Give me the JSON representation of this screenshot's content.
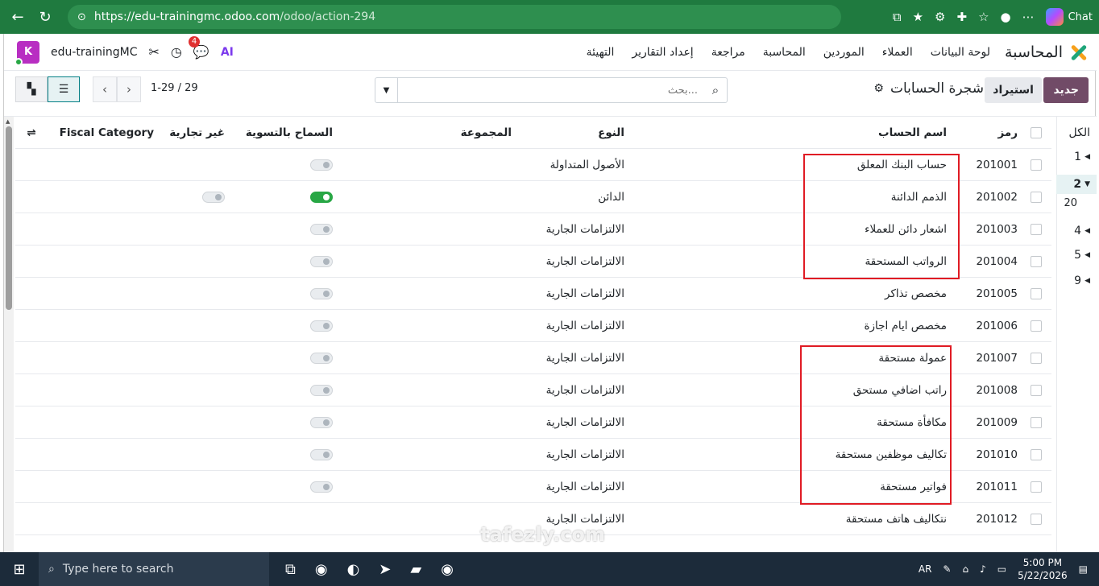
{
  "browser": {
    "url_host": "https://edu-trainingmc.odoo.com",
    "url_path": "/odoo/action-294",
    "chat_label": "Chat"
  },
  "navbar": {
    "app_name": "المحاسبة",
    "menu": [
      "لوحة البيانات",
      "العملاء",
      "الموردين",
      "المحاسبة",
      "مراجعة",
      "إعداد التقارير",
      "التهيئة"
    ],
    "company_initial": "K",
    "company_name": "edu-trainingMC",
    "message_count": "4",
    "ai_label": "AI"
  },
  "control": {
    "new_label": "جديد",
    "import_label": "استيراد",
    "breadcrumb_title": "شجرة الحسابات",
    "search_placeholder": "بحث...",
    "pager": "1-29 / 29"
  },
  "table": {
    "headers": {
      "code": "رمز",
      "name": "اسم الحساب",
      "type": "النوع",
      "group": "المجموعة",
      "reconcile": "السماح بالتسوية",
      "non_trade": "غير تجارية",
      "fiscal": "Fiscal Category"
    },
    "rows": [
      {
        "code": "201001",
        "name": "حساب البنك المعلق",
        "type": "الأصول المتداولة",
        "reconcile": false,
        "non_trade": null
      },
      {
        "code": "201002",
        "name": "الذمم الدائنة",
        "type": "الدائن",
        "reconcile": true,
        "non_trade": false
      },
      {
        "code": "201003",
        "name": "اشعار دائن للعملاء",
        "type": "الالتزامات الجارية",
        "reconcile": false,
        "non_trade": null
      },
      {
        "code": "201004",
        "name": "الرواتب المستحقة",
        "type": "الالتزامات الجارية",
        "reconcile": false,
        "non_trade": null
      },
      {
        "code": "201005",
        "name": "مخصص تذاكر",
        "type": "الالتزامات الجارية",
        "reconcile": false,
        "non_trade": null
      },
      {
        "code": "201006",
        "name": "مخصص ايام اجازة",
        "type": "الالتزامات الجارية",
        "reconcile": false,
        "non_trade": null
      },
      {
        "code": "201007",
        "name": "عمولة مستحقة",
        "type": "الالتزامات الجارية",
        "reconcile": false,
        "non_trade": null
      },
      {
        "code": "201008",
        "name": "راتب اضافي مستحق",
        "type": "الالتزامات الجارية",
        "reconcile": false,
        "non_trade": null
      },
      {
        "code": "201009",
        "name": "مكافأة مستحقة",
        "type": "الالتزامات الجارية",
        "reconcile": false,
        "non_trade": null
      },
      {
        "code": "201010",
        "name": "تكاليف موظفين مستحقة",
        "type": "الالتزامات الجارية",
        "reconcile": false,
        "non_trade": null
      },
      {
        "code": "201011",
        "name": "فواتير مستحقة",
        "type": "الالتزامات الجارية",
        "reconcile": false,
        "non_trade": null
      },
      {
        "code": "201012",
        "name": "نتكاليف هاتف مستحقة",
        "type": "الالتزامات الجارية",
        "reconcile": null,
        "non_trade": null
      }
    ]
  },
  "group_panel": {
    "all_label": "الكل",
    "items": [
      "1",
      "2",
      "4",
      "5",
      "9"
    ],
    "sub_item": "20"
  },
  "watermark": "tafezly.com",
  "taskbar": {
    "search_placeholder": "Type here to search",
    "lang": "AR",
    "time": "5:00 PM",
    "date": "5/22/2026"
  },
  "colors": {
    "browser_bar": "#1f7a3f",
    "primary": "#714b67",
    "toggle_on": "#28a745",
    "annotation": "#e01b24"
  }
}
